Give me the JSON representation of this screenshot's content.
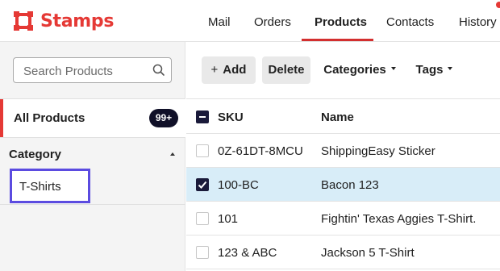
{
  "brand": {
    "name": "Stamps",
    "color": "#e53935"
  },
  "nav": {
    "items": [
      {
        "label": "Mail",
        "active": false
      },
      {
        "label": "Orders",
        "active": false
      },
      {
        "label": "Products",
        "active": true
      },
      {
        "label": "Contacts",
        "active": false
      },
      {
        "label": "History",
        "active": false
      }
    ]
  },
  "sidebar": {
    "search_placeholder": "Search Products",
    "all_products": {
      "label": "All Products",
      "count_badge": "99+"
    },
    "category": {
      "header": "Category",
      "expanded": true,
      "items": [
        {
          "label": "T-Shirts",
          "highlighted": true
        }
      ]
    }
  },
  "toolbar": {
    "add_label": "Add",
    "add_icon": "+",
    "delete_label": "Delete",
    "categories_label": "Categories",
    "tags_label": "Tags"
  },
  "table": {
    "columns": [
      "SKU",
      "Name"
    ],
    "header_checkbox": "indeterminate",
    "rows": [
      {
        "sku": "0Z-61DT-8MCU",
        "name": "ShippingEasy Sticker",
        "checked": false
      },
      {
        "sku": "100-BC",
        "name": "Bacon 123",
        "checked": true
      },
      {
        "sku": "101",
        "name": "Fightin' Texas Aggies T-Shirt.",
        "checked": false
      },
      {
        "sku": "123 & ABC",
        "name": "Jackson 5 T-Shirt",
        "checked": false
      }
    ]
  },
  "colors": {
    "accent": "#e53935",
    "selected_row": "#d8edf8",
    "badge": "#101028",
    "highlight_border": "#5b4be0"
  }
}
